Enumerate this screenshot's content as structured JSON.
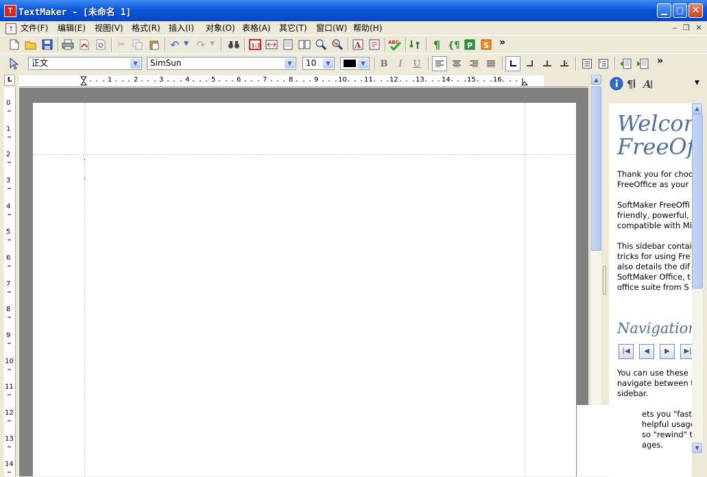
{
  "window": {
    "title": "TextMaker - [未命名 1]",
    "app_icon": "T",
    "minimize": "▁",
    "maximize": "□",
    "close": "✕"
  },
  "menu": {
    "items": [
      "文件(F)",
      "编辑(E)",
      "视图(V)",
      "格式(R)",
      "插入(I)",
      "对象(O)",
      "表格(A)",
      "其它(T)",
      "窗口(W)",
      "帮助(H)"
    ],
    "mdi_minimize": "‒",
    "mdi_restore": "❐",
    "mdi_close": "✕"
  },
  "toolbar_format": {
    "style": "正文",
    "font": "SimSun",
    "size": "10",
    "text_color": "#000000",
    "bold": "B",
    "italic": "I",
    "underline": "U"
  },
  "icons": {
    "bold_tb": "¶",
    "more": "»"
  },
  "ruler": {
    "corner": "L",
    "h_numbers": [
      "1",
      "2",
      "3",
      "4",
      "5",
      "6",
      "7",
      "8",
      "9",
      "10",
      "11",
      "12",
      "13",
      "14",
      "15",
      "16"
    ],
    "v_numbers": [
      "0",
      "1",
      "2",
      "3",
      "4",
      "5",
      "6",
      "7",
      "8",
      "9",
      "10",
      "11",
      "12",
      "13",
      "14"
    ]
  },
  "sidebar": {
    "heading_welcome_1": "Welcom",
    "heading_welcome_2": "FreeOffi",
    "p1_l1": "Thank you for choo",
    "p1_l2": "FreeOffice as your",
    "p2_l1": "SoftMaker FreeOffi",
    "p2_l2": "friendly, powerful,",
    "p2_l3": "compatible with Mi",
    "p3_l1": "This sidebar contai",
    "p3_l2": "tricks for using Fre",
    "p3_l3": "also details the dif",
    "p3_l4": "SoftMaker Office, t",
    "p3_l5": "office suite from S",
    "heading_navigation": "Navigation",
    "p4_l1": "You can use these",
    "p4_l2": "navigate between t",
    "p4_l3": "sidebar.",
    "p5_l1": "ets you \"fast-",
    "p5_l2": "helpful usage",
    "p5_l3": "so \"rewind\" t",
    "p5_l4": "ages."
  }
}
